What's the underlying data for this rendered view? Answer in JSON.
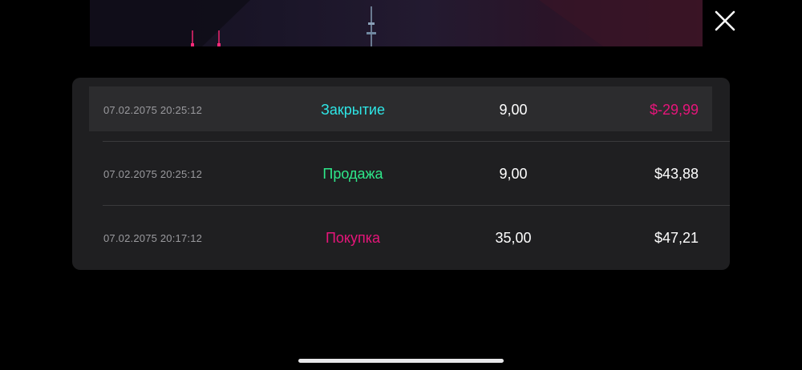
{
  "header": {
    "close_icon": "close-icon"
  },
  "history": {
    "rows": [
      {
        "date": "07.02.2075 20:25:12",
        "type": "Закрытие",
        "quantity": "9,00",
        "total": "$-29,99"
      },
      {
        "date": "07.02.2075 20:25:12",
        "type": "Продажа",
        "quantity": "9,00",
        "total": "$43,88"
      },
      {
        "date": "07.02.2075 20:17:12",
        "type": "Покупка",
        "quantity": "35,00",
        "total": "$47,21"
      }
    ]
  },
  "colors": {
    "close": "#2ee6e6",
    "sell": "#2ee88a",
    "buy": "#e6157a",
    "negative": "#e6157a",
    "positive": "#ffffff"
  }
}
